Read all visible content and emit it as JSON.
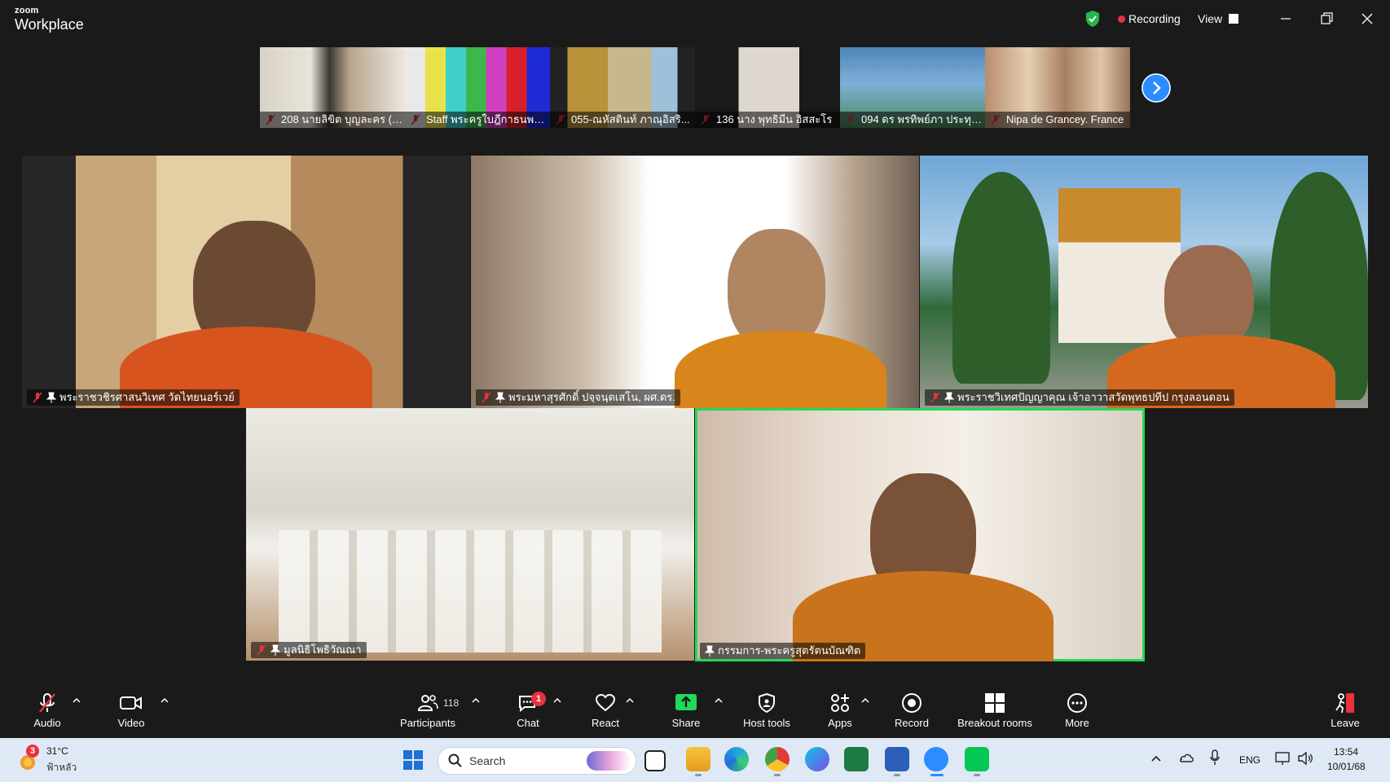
{
  "app": {
    "brand_small": "zoom",
    "brand_big": "Workplace"
  },
  "titlebar": {
    "recording_label": "Recording",
    "view_label": "View"
  },
  "filmstrip": [
    {
      "name": "208 นายลิขิต บุญละคร (เอ)"
    },
    {
      "name": "Staff พระครูใบฎีกาธนพล ..."
    },
    {
      "name": "055-ณหัสดินท์ ภาณุอิสริ..."
    },
    {
      "name": "136 นาง พุทธิมีน อิสสะโร"
    },
    {
      "name": "094 ดร พรทิพย์ภา ประทุม..."
    },
    {
      "name": "Nipa de Grancey. France"
    }
  ],
  "gallery": [
    {
      "name": "พระราชวชิรศาสนวิเทศ วัดไทยนอร์เวย์"
    },
    {
      "name": "พระมหาสุรศักดิ์ ปจฺจนฺตเสโน, ผศ.ดร."
    },
    {
      "name": "พระราชวิเทศปัญญาคุณ เจ้าอาวาสวัดพุทธปทีป กรุงลอนดอน"
    },
    {
      "name": "มูลนิธิโพธิวัณณา"
    },
    {
      "name": "กรรมการ-พระครูสุตรัตนบัณฑิต"
    }
  ],
  "toolbar": {
    "audio": "Audio",
    "video": "Video",
    "participants": "Participants",
    "participants_count": "118",
    "chat": "Chat",
    "chat_badge": "1",
    "react": "React",
    "share": "Share",
    "host_tools": "Host tools",
    "apps": "Apps",
    "record": "Record",
    "breakout": "Breakout rooms",
    "more": "More",
    "leave": "Leave"
  },
  "taskbar": {
    "weather_badge": "3",
    "temperature": "31°C",
    "weather_desc": "ฟ้าหลัว",
    "search_label": "Search",
    "lang": "ENG",
    "time": "13:54",
    "date": "10/01/68"
  },
  "colors": {
    "accent_blue": "#2d8cff",
    "active_speaker": "#23d959",
    "share_green": "#23d959",
    "recording_red": "#e8323c"
  }
}
